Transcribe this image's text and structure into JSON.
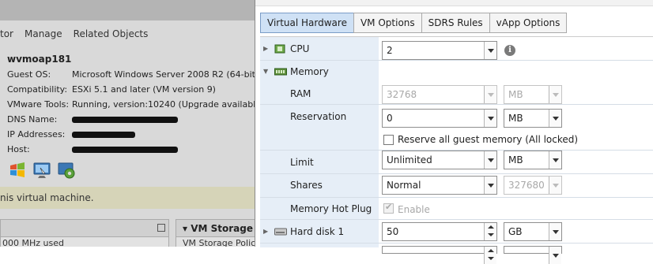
{
  "background": {
    "tabs": [
      "tor",
      "Manage",
      "Related Objects"
    ],
    "vm_name": "wvmoap181",
    "properties": [
      {
        "key": "Guest OS:",
        "value": "Microsoft Windows Server 2008 R2 (64-bit)"
      },
      {
        "key": "Compatibility:",
        "value": "ESXi 5.1 and later (VM version 9)"
      },
      {
        "key": "VMware Tools:",
        "value": "Running, version:10240 (Upgrade available)"
      },
      {
        "key": "DNS Name:",
        "value": ""
      },
      {
        "key": "IP Addresses:",
        "value": ""
      },
      {
        "key": "Host:",
        "value": ""
      }
    ],
    "banner_text": "nis virtual machine.",
    "panel_left_text": "000 MHz used",
    "panel_right_title": "VM Storage I",
    "panel_right_text": "VM Storage Polic"
  },
  "dialog": {
    "tabs": [
      {
        "label": "Virtual Hardware",
        "active": true
      },
      {
        "label": "VM Options",
        "active": false
      },
      {
        "label": "SDRS Rules",
        "active": false
      },
      {
        "label": "vApp Options",
        "active": false
      }
    ],
    "cpu": {
      "label": "CPU",
      "value": "2",
      "icon": "cpu-chip-icon",
      "info_icon": "info-icon"
    },
    "memory": {
      "label": "Memory",
      "icon": "memory-module-icon",
      "ram": {
        "label": "RAM",
        "value": "32768",
        "unit": "MB"
      },
      "reservation": {
        "label": "Reservation",
        "value": "0",
        "unit": "MB",
        "reserve_all_label": "Reserve all guest memory (All locked)",
        "reserve_all_checked": false
      },
      "limit": {
        "label": "Limit",
        "value": "Unlimited",
        "unit": "MB"
      },
      "shares": {
        "label": "Shares",
        "value": "Normal",
        "count": "327680"
      },
      "hot_plug": {
        "label": "Memory Hot Plug",
        "enable_label": "Enable",
        "checked": true
      }
    },
    "hard_disk": {
      "label": "Hard disk 1",
      "value": "50",
      "unit": "GB",
      "icon": "hard-disk-icon"
    }
  },
  "colors": {
    "dialog_label_column": "#e6eef7",
    "active_tab": "#cfe1f5",
    "background_overlay": "#d9d9d9"
  }
}
